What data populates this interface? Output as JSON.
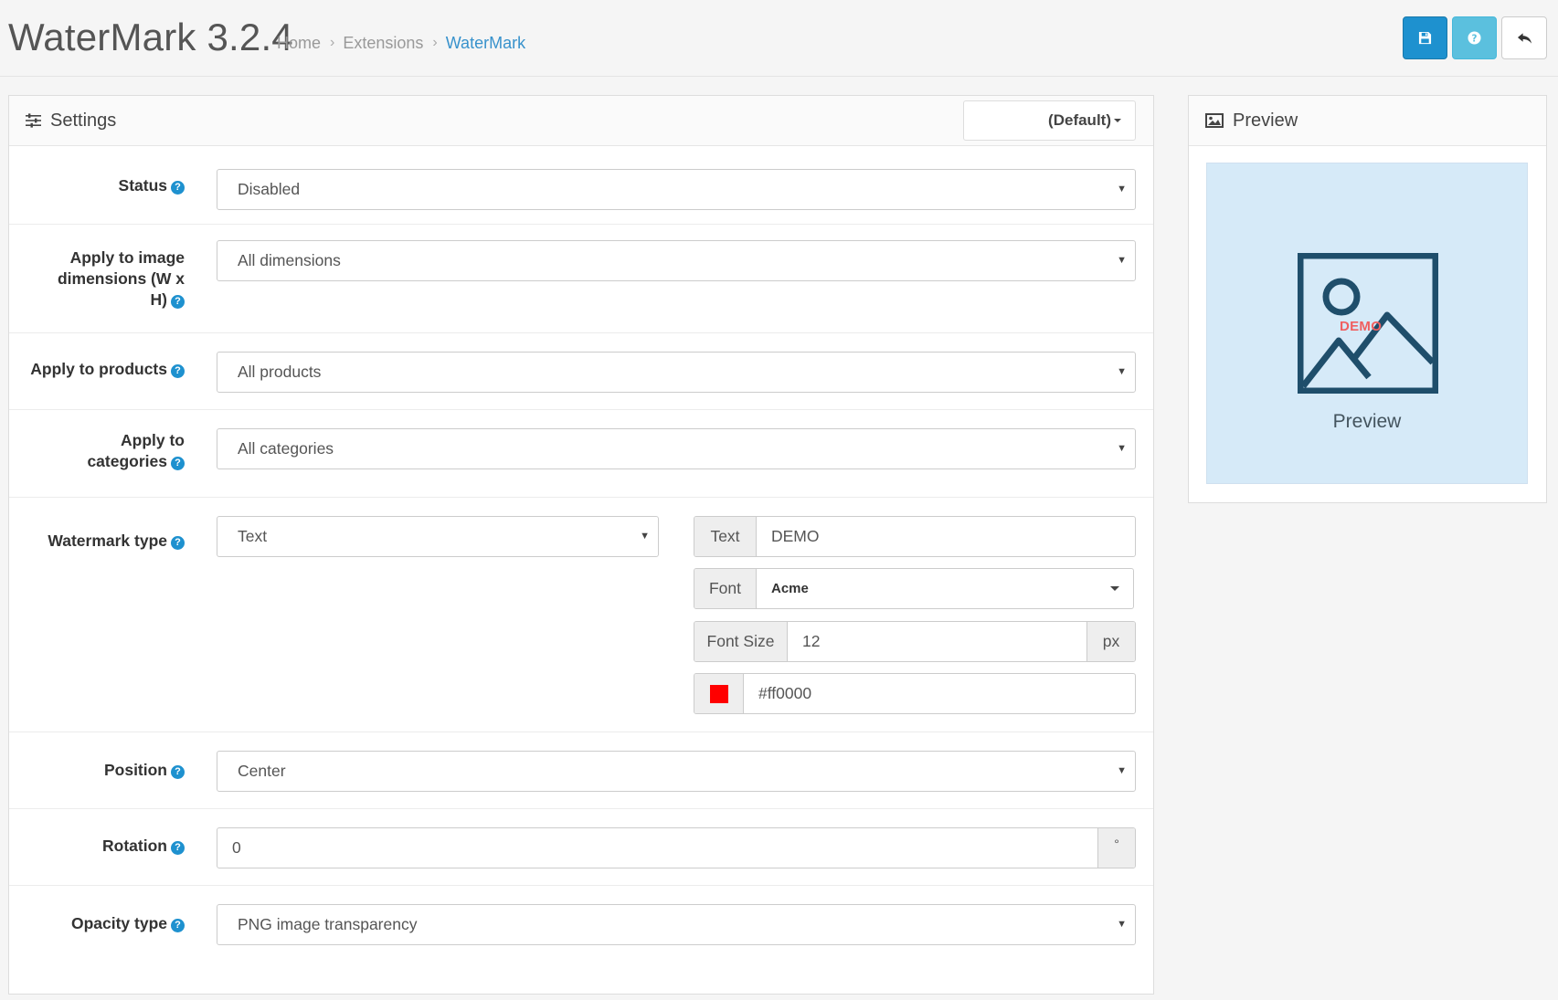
{
  "header": {
    "title": "WaterMark 3.2.4",
    "breadcrumb": [
      {
        "label": "Home"
      },
      {
        "label": "Extensions"
      },
      {
        "label": "WaterMark"
      }
    ],
    "buttons": {
      "save_icon": "floppy-disk-icon",
      "help_icon": "question-icon",
      "back_icon": "reply-arrow-icon"
    }
  },
  "settings": {
    "title": "Settings",
    "icon": "sliders-icon",
    "language": "(Default)",
    "status": {
      "label": "Status",
      "value": "Disabled"
    },
    "dimensions": {
      "label_lines": [
        "Apply to image",
        "dimensions (W x",
        "H)"
      ],
      "value": "All dimensions"
    },
    "products": {
      "label": "Apply to products",
      "value": "All products"
    },
    "categories": {
      "label_lines": [
        "Apply to",
        "categories"
      ],
      "value": "All categories"
    },
    "watermark_type": {
      "label": "Watermark type",
      "value": "Text"
    },
    "text": {
      "addon": "Text",
      "value": "DEMO"
    },
    "font": {
      "addon": "Font",
      "value": "Acme"
    },
    "font_size": {
      "addon": "Font Size",
      "value": "12",
      "unit": "px"
    },
    "color": {
      "value": "#ff0000",
      "swatch": "#ff0000"
    },
    "position": {
      "label": "Position",
      "value": "Center"
    },
    "rotation": {
      "label": "Rotation",
      "value": "0",
      "unit": "°"
    },
    "opacity_type": {
      "label": "Opacity type",
      "value": "PNG image transparency"
    }
  },
  "preview": {
    "title": "Preview",
    "icon": "image-icon",
    "caption": "Preview",
    "watermark_text": "DEMO"
  },
  "colors": {
    "primary": "#1e91cf",
    "info": "#5bc0de",
    "breadcrumb_active": "#3892cc",
    "preview_bg": "#d6eaf8",
    "preview_icon": "#1f4e6b"
  }
}
